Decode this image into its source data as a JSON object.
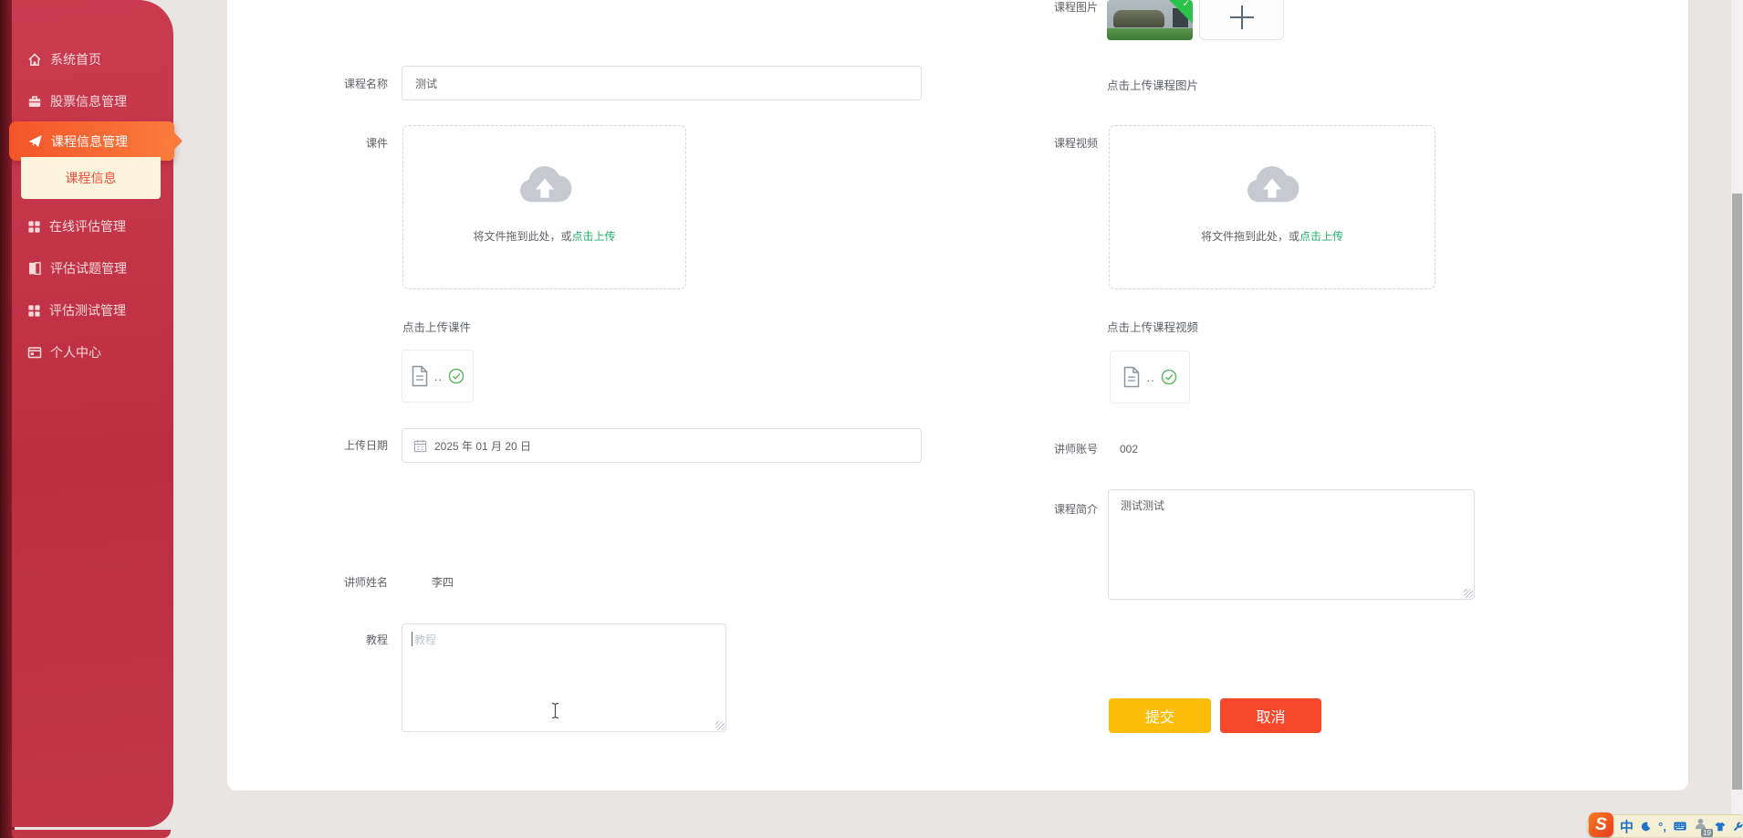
{
  "sidebar": {
    "items": [
      {
        "label": "系统首页"
      },
      {
        "label": "股票信息管理"
      },
      {
        "label": "课程信息管理"
      },
      {
        "label": "在线评估管理"
      },
      {
        "label": "评估试题管理"
      },
      {
        "label": "评估测试管理"
      },
      {
        "label": "个人中心"
      }
    ],
    "active_item": "课程信息管理",
    "submenu_label": "课程信息"
  },
  "form": {
    "course_name_label": "课程名称",
    "course_name_value": "测试",
    "courseware_label": "课件",
    "courseware_drop_prefix": "将文件拖到此处，或",
    "courseware_drop_link": "点击上传",
    "courseware_hint": "点击上传课件",
    "courseware_file_name": "..",
    "upload_date_label": "上传日期",
    "upload_date_value": "2025 年 01 月 20 日",
    "instructor_name_label": "讲师姓名",
    "instructor_name_value": "李四",
    "tutorial_label": "教程",
    "tutorial_placeholder": "教程",
    "course_image_label": "课程图片",
    "course_image_hint": "点击上传课程图片",
    "course_video_label": "课程视频",
    "video_drop_prefix": "将文件拖到此处，或",
    "video_drop_link": "点击上传",
    "course_video_hint": "点击上传课程视频",
    "video_file_name": "..",
    "instructor_account_label": "讲师账号",
    "instructor_account_value": "002",
    "course_intro_label": "课程简介",
    "course_intro_value": "测试测试",
    "submit_label": "提交",
    "cancel_label": "取消"
  },
  "ime_toolbar": {
    "logo_text": "S",
    "lang_text": "中",
    "punct_text": "°,",
    "badge_count": "19"
  },
  "colors": {
    "accent_green": "#21b26b",
    "success_green": "#55b85f",
    "image_badge_green": "#2bc24a",
    "submit_yellow": "#fbbd0a",
    "cancel_red": "#f8482b",
    "sidebar_red": "#c23447",
    "active_orange_start": "#f3552a",
    "active_orange_end": "#fa7b3c",
    "submenu_bg": "#fcf3dc",
    "submenu_text": "#f0503b",
    "label_gray": "#606266",
    "placeholder_gray": "#c0c4cc",
    "border_gray": "#dcdfe6"
  }
}
